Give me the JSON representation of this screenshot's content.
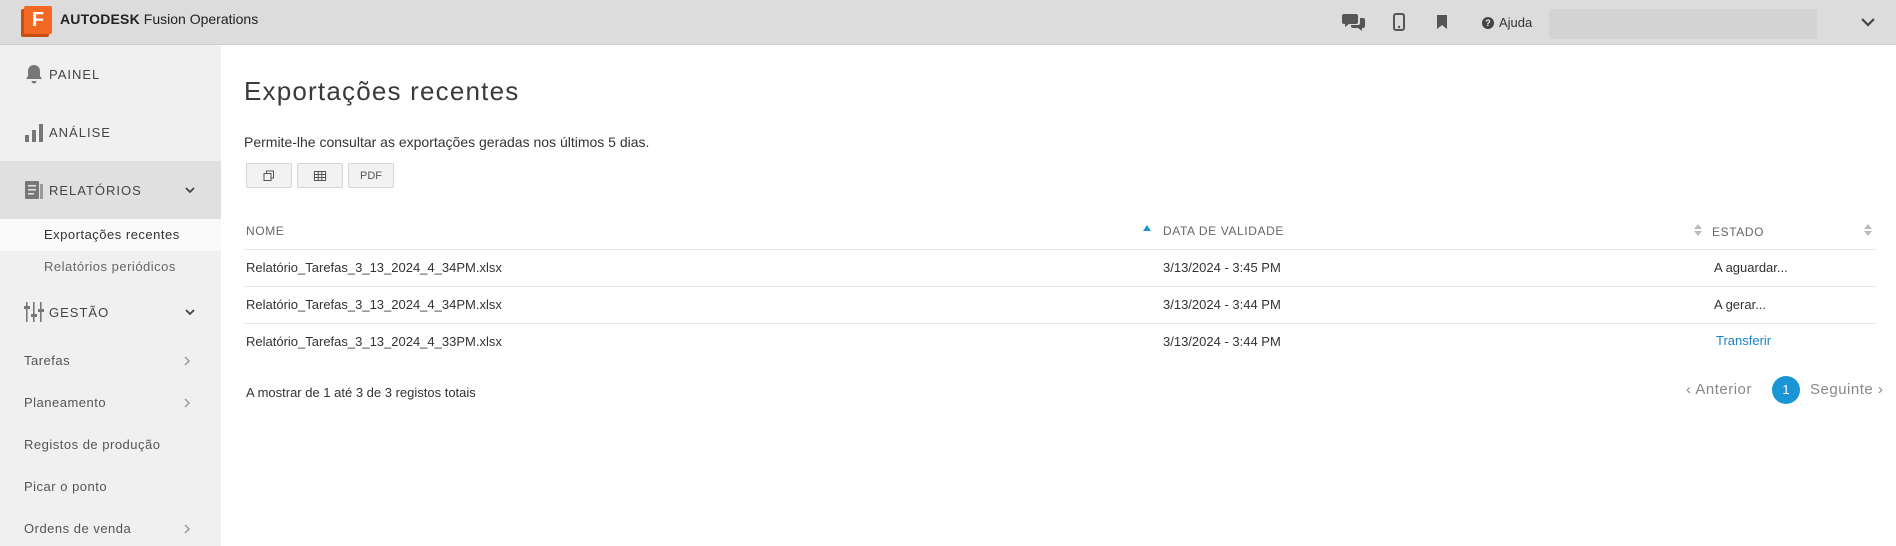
{
  "header": {
    "logo_letter": "F",
    "brand_bold": "AUTODESK",
    "brand_product": "Fusion Operations",
    "icons": [
      "chat-icon",
      "mobile-icon",
      "bookmark-icon"
    ],
    "help_label": "Ajuda"
  },
  "sidebar": {
    "painel": "PAINEL",
    "analise": "ANÁLISE",
    "relatorios": "RELATÓRIOS",
    "relatorios_sub": [
      "Exportações recentes",
      "Relatórios periódicos"
    ],
    "gestao": "GESTÃO",
    "links": [
      "Tarefas",
      "Planeamento",
      "Registos de produção",
      "Picar o ponto",
      "Ordens de venda"
    ]
  },
  "main": {
    "title": "Exportações recentes",
    "description": "Permite-lhe consultar as exportações geradas nos últimos 5 dias.",
    "pdf_button": "PDF",
    "columns": [
      "NOME",
      "DATA DE VALIDADE",
      "ESTADO"
    ],
    "rows": [
      {
        "name": "Relatório_Tarefas_3_13_2024_4_34PM.xlsx",
        "date": "3/13/2024 - 3:45 PM",
        "status": "A aguardar..."
      },
      {
        "name": "Relatório_Tarefas_3_13_2024_4_34PM.xlsx",
        "date": "3/13/2024 - 3:44 PM",
        "status": "A gerar..."
      },
      {
        "name": "Relatório_Tarefas_3_13_2024_4_33PM.xlsx",
        "date": "3/13/2024 - 3:44 PM",
        "status": "Transferir"
      }
    ],
    "summary": "A mostrar de 1 até 3 de 3 registos totais",
    "pagination": {
      "prev": "Anterior",
      "current": "1",
      "next": "Seguinte"
    }
  },
  "colors": {
    "accent": "#1a96d6",
    "link": "#1a84c7",
    "brand": "#f26722"
  }
}
